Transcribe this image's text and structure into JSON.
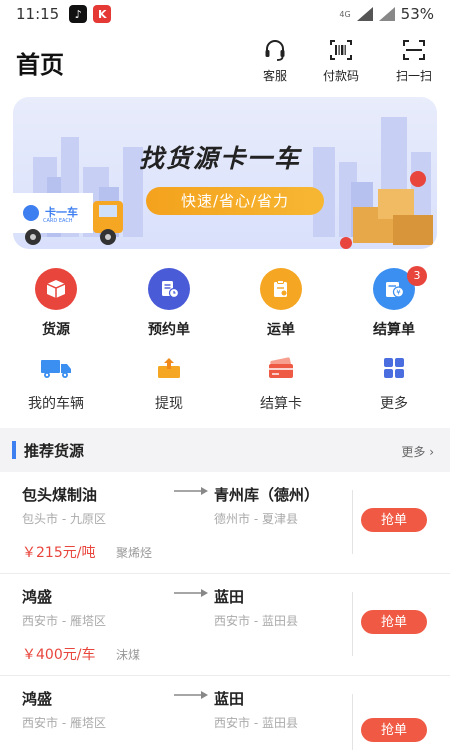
{
  "status_bar": {
    "time": "11:15",
    "network": "4G",
    "battery": "53%"
  },
  "header": {
    "title": "首页",
    "actions": [
      {
        "label": "客服",
        "icon": "headset-icon"
      },
      {
        "label": "付款码",
        "icon": "barcode-icon"
      },
      {
        "label": "扫一扫",
        "icon": "scan-icon"
      }
    ]
  },
  "banner": {
    "title": "找货源卡一车",
    "subtitle": "快速/省心/省力",
    "truck_brand": "卡一车",
    "truck_brand_en": "CARD EACH"
  },
  "categories": [
    {
      "label": "货源",
      "icon": "cargo-box-icon",
      "color": "#e8453c"
    },
    {
      "label": "预约单",
      "icon": "appointment-doc-icon",
      "color": "#4a5bd8"
    },
    {
      "label": "运单",
      "icon": "waybill-icon",
      "color": "#f5a623"
    },
    {
      "label": "结算单",
      "icon": "settlement-icon",
      "color": "#3b8ff0",
      "badge": "3"
    }
  ],
  "shortcuts": [
    {
      "label": "我的车辆",
      "icon": "truck-icon"
    },
    {
      "label": "提现",
      "icon": "withdraw-icon"
    },
    {
      "label": "结算卡",
      "icon": "card-icon"
    },
    {
      "label": "更多",
      "icon": "grid-icon"
    }
  ],
  "section": {
    "title": "推荐货源",
    "more": "更多 ›"
  },
  "listings": [
    {
      "from": "包头煤制油",
      "to": "青州库（德州）",
      "from_area": "包头市 - 九原区",
      "to_area": "德州市 - 夏津县",
      "price": "￥215元/吨",
      "goods": "聚烯烃",
      "action": "抢单"
    },
    {
      "from": "鸿盛",
      "to": "蓝田",
      "from_area": "西安市 - 雁塔区",
      "to_area": "西安市 - 蓝田县",
      "price": "￥400元/车",
      "goods": "沫煤",
      "action": "抢单"
    },
    {
      "from": "鸿盛",
      "to": "蓝田",
      "from_area": "西安市 - 雁塔区",
      "to_area": "西安市 - 蓝田县",
      "price": "",
      "goods": "",
      "action": "抢单"
    }
  ],
  "colors": {
    "accent_blue": "#3d7ef0",
    "accent_red": "#f05a45",
    "price_red": "#e8453c",
    "banner_orange": "#f4a21d"
  }
}
